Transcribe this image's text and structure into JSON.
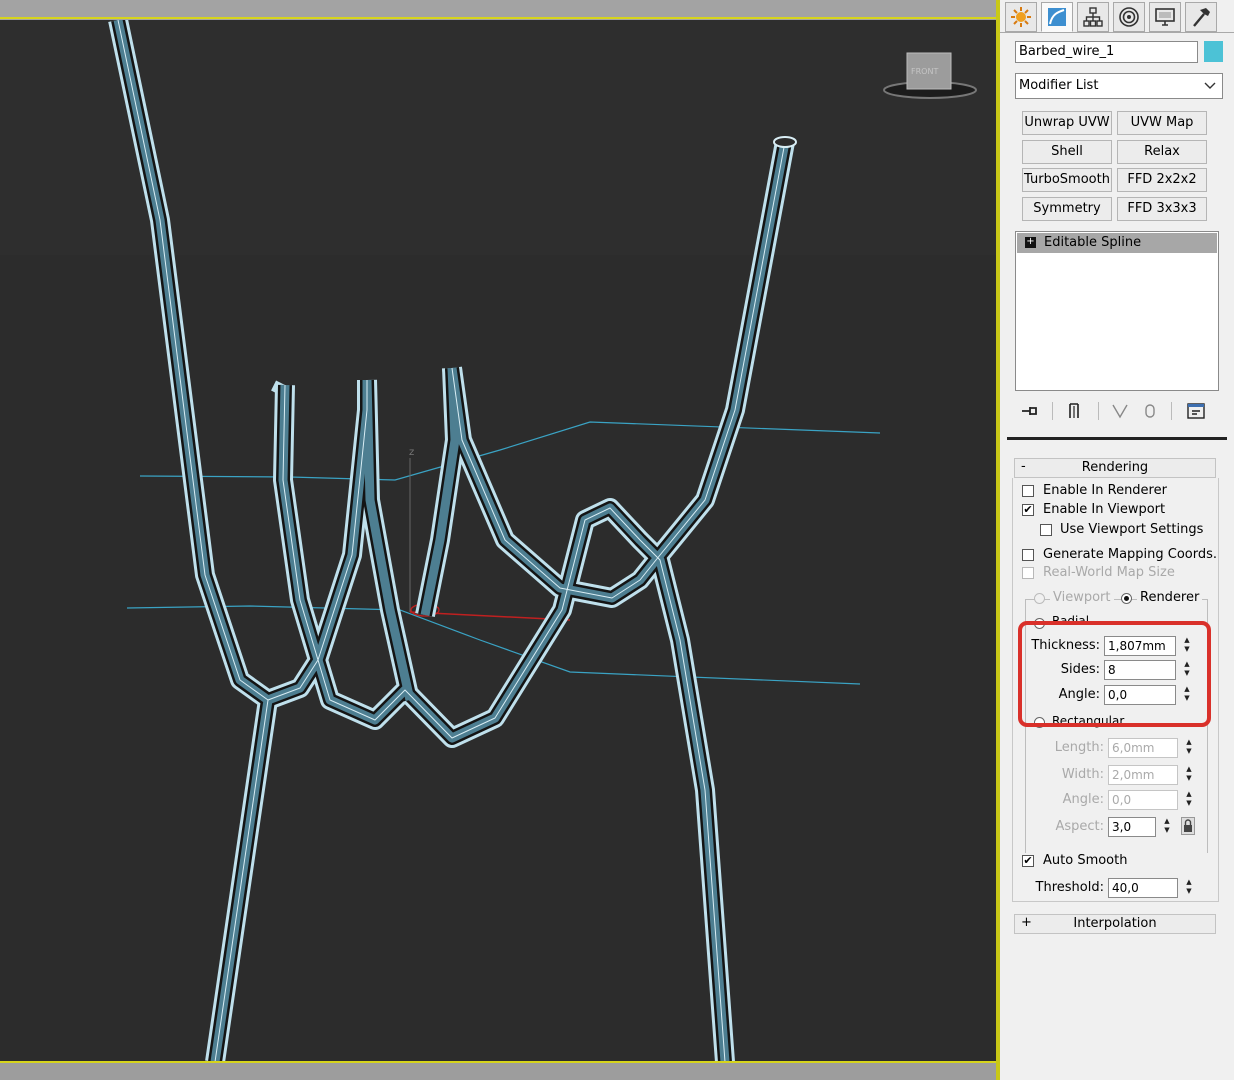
{
  "viewport": {
    "view_label": "FRONT",
    "axis_label": "z"
  },
  "panel": {
    "tabs": [
      {
        "name": "create-tab",
        "icon": "sun-icon"
      },
      {
        "name": "modify-tab",
        "icon": "modify-icon"
      },
      {
        "name": "hierarchy-tab",
        "icon": "hierarchy-icon"
      },
      {
        "name": "motion-tab",
        "icon": "motion-icon"
      },
      {
        "name": "display-tab",
        "icon": "display-icon"
      },
      {
        "name": "utilities-tab",
        "icon": "hammer-icon"
      }
    ],
    "object_name": "Barbed_wire_1",
    "object_color": "#4cc2d6",
    "modifier_list_label": "Modifier List",
    "modifier_buttons": [
      "Unwrap UVW",
      "UVW Map",
      "Shell",
      "Relax",
      "TurboSmooth",
      "FFD 2x2x2",
      "Symmetry",
      "FFD 3x3x3"
    ],
    "stack": {
      "items": [
        {
          "label": "Editable Spline",
          "expander": "+"
        }
      ]
    },
    "rendering": {
      "toggle": "-",
      "title": "Rendering",
      "enable_in_renderer": {
        "label": "Enable In Renderer",
        "checked": false
      },
      "enable_in_viewport": {
        "label": "Enable In Viewport",
        "checked": true
      },
      "use_viewport_settings": {
        "label": "Use Viewport Settings",
        "checked": false
      },
      "generate_mapping_coords": {
        "label": "Generate Mapping Coords.",
        "checked": false
      },
      "real_world_map_size": {
        "label": "Real-World Map Size",
        "checked": false
      },
      "viewport_radio": "Viewport",
      "renderer_radio": "Renderer",
      "radial_label": "Radial",
      "thickness_label": "Thickness:",
      "thickness_value": "1,807mm",
      "sides_label": "Sides:",
      "sides_value": "8",
      "angle_label": "Angle:",
      "angle_value": "0,0",
      "rectangular_label": "Rectangular",
      "length_label": "Length:",
      "length_value": "6,0mm",
      "width_label": "Width:",
      "width_value": "2,0mm",
      "rect_angle_label": "Angle:",
      "rect_angle_value": "0,0",
      "aspect_label": "Aspect:",
      "aspect_value": "3,0",
      "auto_smooth": {
        "label": "Auto Smooth",
        "checked": true
      },
      "threshold_label": "Threshold:",
      "threshold_value": "40,0"
    },
    "interpolation": {
      "toggle": "+",
      "title": "Interpolation"
    },
    "highlight_color": "#d9302a"
  }
}
